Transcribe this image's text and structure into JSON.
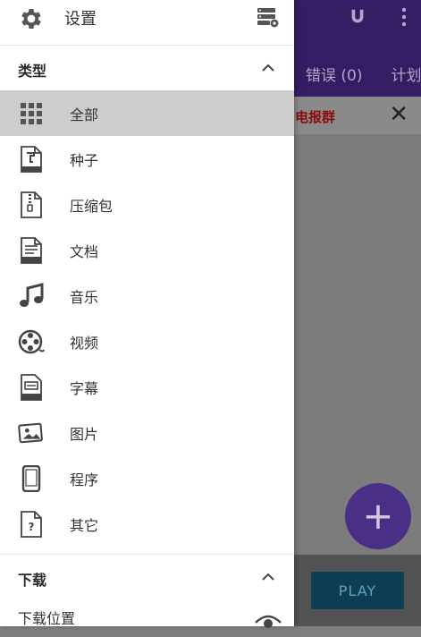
{
  "background": {
    "tabs": [
      "错误 (0)",
      "计划"
    ],
    "banner_text": "电报群",
    "banner_close": "✕",
    "fab_label": "+",
    "play_label": "PLAY"
  },
  "drawer": {
    "header_title": "设置",
    "categories_section": "类型",
    "categories": [
      {
        "label": "全部",
        "icon": "grid-icon",
        "selected": true
      },
      {
        "label": "种子",
        "icon": "torrent-file-icon"
      },
      {
        "label": "压缩包",
        "icon": "zip-file-icon"
      },
      {
        "label": "文档",
        "icon": "doc-file-icon"
      },
      {
        "label": "音乐",
        "icon": "music-note-icon"
      },
      {
        "label": "视频",
        "icon": "film-reel-icon"
      },
      {
        "label": "字幕",
        "icon": "srt-file-icon"
      },
      {
        "label": "图片",
        "icon": "image-icon"
      },
      {
        "label": "程序",
        "icon": "phone-icon"
      },
      {
        "label": "其它",
        "icon": "unknown-file-icon"
      }
    ],
    "download_section": "下载",
    "download_location_label": "下载位置"
  }
}
